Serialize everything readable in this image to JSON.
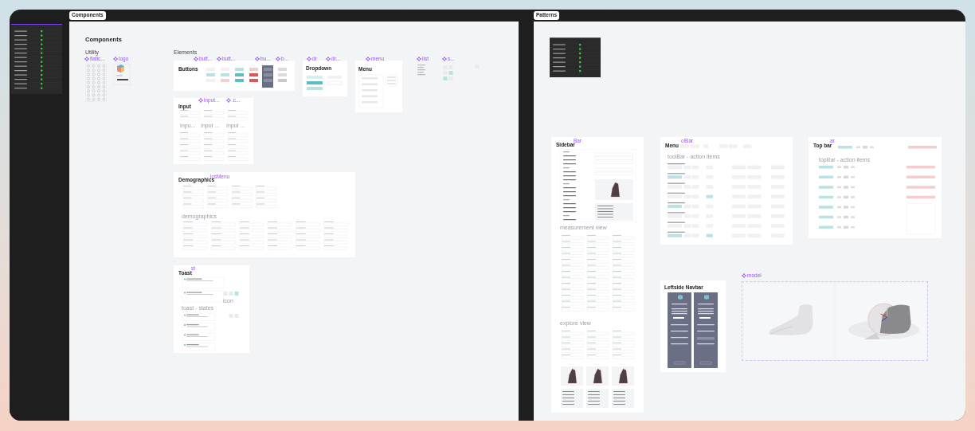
{
  "left_panel": {
    "kind": "table"
  },
  "frames": [
    {
      "label": "Components",
      "items": [
        {
          "kind": "heading",
          "text": "Components"
        },
        {
          "kind": "section",
          "text": "Utility"
        },
        {
          "kind": "section",
          "text": "Elements"
        },
        {
          "kind": "tag",
          "text": "flatic...",
          "diamond": true
        },
        {
          "kind": "tag",
          "text": "logo",
          "diamond": true
        },
        {
          "kind": "icons"
        },
        {
          "kind": "logo"
        },
        {
          "kind": "card"
        },
        {
          "kind": "title",
          "text": "Buttons"
        },
        {
          "kind": "tag",
          "text": "butt...",
          "diamond": true
        },
        {
          "kind": "tag",
          "text": "butt...",
          "diamond": true
        },
        {
          "kind": "tag",
          "text": "bu...",
          "diamond": true
        },
        {
          "kind": "tag",
          "text": "b...",
          "diamond": true
        },
        {
          "kind": "buttons"
        },
        {
          "kind": "card"
        },
        {
          "kind": "title",
          "text": "Dropdown"
        },
        {
          "kind": "tag",
          "text": "dr",
          "diamond": true
        },
        {
          "kind": "tag",
          "text": "dr...",
          "diamond": true
        },
        {
          "kind": "dropdown"
        },
        {
          "kind": "card"
        },
        {
          "kind": "title",
          "text": "Menu"
        },
        {
          "kind": "tag",
          "text": "menu",
          "diamond": true
        },
        {
          "kind": "menu"
        },
        {
          "kind": "tag",
          "text": "list",
          "diamond": true
        },
        {
          "kind": "list"
        },
        {
          "kind": "tag",
          "text": "s...",
          "diamond": true
        },
        {
          "kind": "chips"
        },
        {
          "kind": "chips"
        },
        {
          "kind": "card"
        },
        {
          "kind": "title",
          "text": "Input"
        },
        {
          "kind": "tag",
          "text": "input...",
          "diamond": true
        },
        {
          "kind": "tag",
          "text": ".c...",
          "diamond": true
        },
        {
          "kind": "form"
        },
        {
          "kind": "caption",
          "text": "Inpu..."
        },
        {
          "kind": "caption",
          "text": "Input ..."
        },
        {
          "kind": "caption",
          "text": "Input ..."
        },
        {
          "kind": "form"
        },
        {
          "kind": "card"
        },
        {
          "kind": "title",
          "text": "Demographics"
        },
        {
          "kind": "tag",
          "text": "icsMenu",
          "diamond": false
        },
        {
          "kind": "form"
        },
        {
          "kind": "caption",
          "text": "demographics"
        },
        {
          "kind": "form"
        },
        {
          "kind": "card"
        },
        {
          "kind": "title",
          "text": "Toast"
        },
        {
          "kind": "tag",
          "text": "st",
          "diamond": false
        },
        {
          "kind": "toast"
        },
        {
          "kind": "chips"
        },
        {
          "kind": "caption",
          "text": "icon"
        },
        {
          "kind": "chips"
        },
        {
          "kind": "caption",
          "text": "toast - states"
        },
        {
          "kind": "toast"
        }
      ]
    },
    {
      "label": "Patterns",
      "items": [
        {
          "kind": "table"
        },
        {
          "kind": "card"
        },
        {
          "kind": "title",
          "text": "Sidebar"
        },
        {
          "kind": "tag",
          "text": "Bar",
          "diamond": false
        },
        {
          "kind": "sidebar"
        },
        {
          "kind": "caption",
          "text": "measurement view"
        },
        {
          "kind": "form"
        },
        {
          "kind": "caption",
          "text": "explore view"
        },
        {
          "kind": "explore"
        },
        {
          "kind": "card"
        },
        {
          "kind": "title",
          "text": "Menu"
        },
        {
          "kind": "tag",
          "text": "olBar",
          "diamond": false
        },
        {
          "kind": "toolbar"
        },
        {
          "kind": "caption",
          "text": "toolBar - action items"
        },
        {
          "kind": "toolbar"
        },
        {
          "kind": "card"
        },
        {
          "kind": "title",
          "text": "Top bar"
        },
        {
          "kind": "tag",
          "text": "ar",
          "diamond": false
        },
        {
          "kind": "topbar"
        },
        {
          "kind": "caption",
          "text": "topBar - action items"
        },
        {
          "kind": "topbar"
        },
        {
          "kind": "card"
        },
        {
          "kind": "title",
          "text": "Leftside Navbar"
        },
        {
          "kind": "navbar"
        },
        {
          "kind": "tag",
          "text": "model",
          "diamond": true
        },
        {
          "kind": "model"
        }
      ]
    }
  ]
}
